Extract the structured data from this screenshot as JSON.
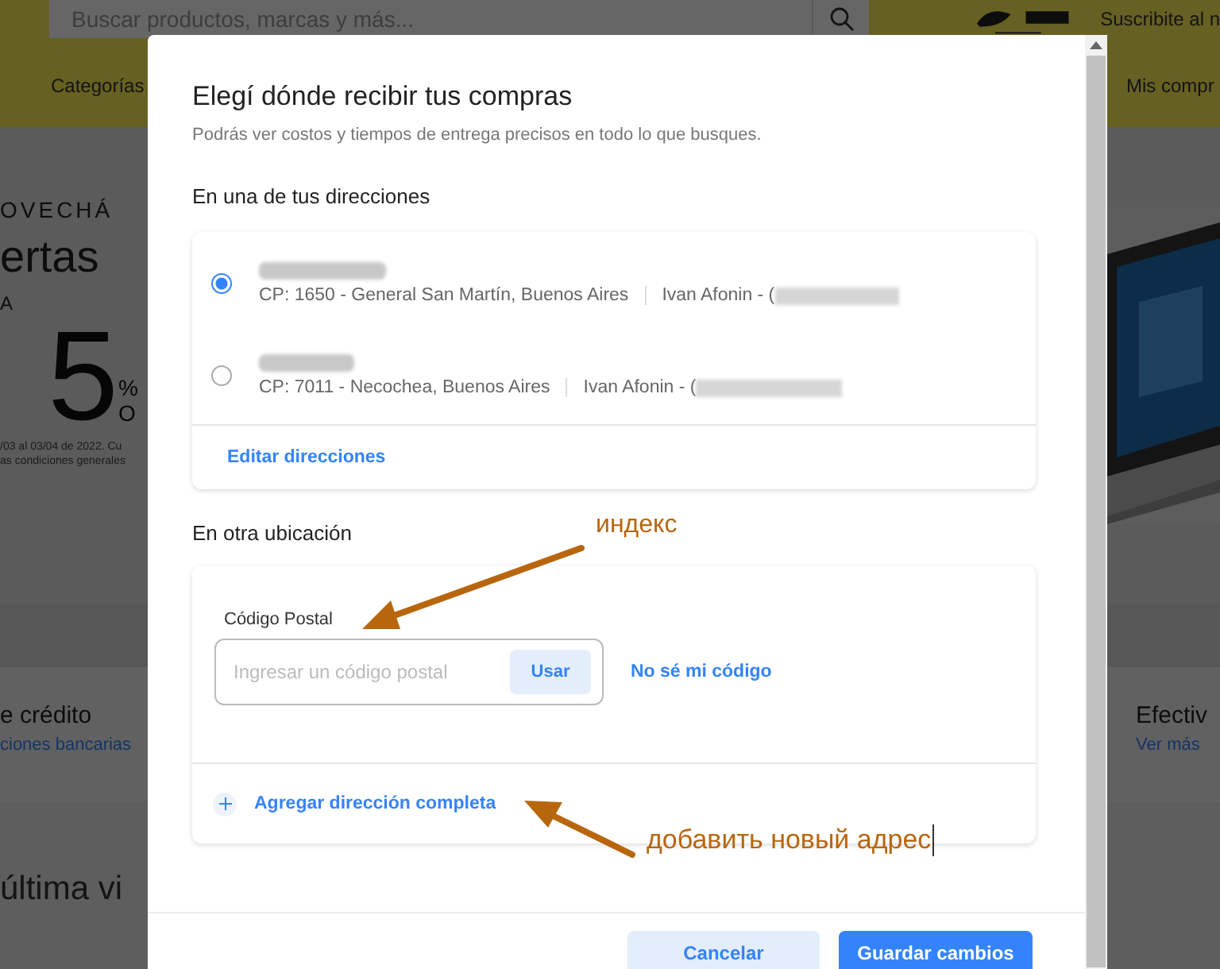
{
  "background_page": {
    "search": {
      "placeholder": "Buscar productos, marcas y más..."
    },
    "promo_text": "Suscribite al n",
    "nav": [
      "Categorías",
      "Mis compr"
    ],
    "hero": {
      "kicker": "OVECHÁ",
      "headline": "ertas",
      "prefix": "A",
      "big": "5",
      "percent": "%",
      "suffix": "O",
      "legal": [
        "/03 al 03/04 de 2022. Cu",
        "as condiciones generales"
      ]
    },
    "payment_cards": [
      {
        "title": "e crédito",
        "link": "ciones bancarias"
      },
      {
        "title": "Efectiv",
        "link": "Ver más"
      }
    ],
    "section_heading": "última vi"
  },
  "modal": {
    "title": "Elegí dónde recibir tus compras",
    "subtitle": "Podrás ver costos y tiempos de entrega precisos en todo lo que busques.",
    "saved_section": {
      "heading": "En una de tus direcciones",
      "addresses": [
        {
          "selected": true,
          "postal": "CP: 1650 - General San Martín, Buenos Aires",
          "contact": "Ivan Afonin - ("
        },
        {
          "selected": false,
          "postal": "CP: 7011 - Necochea, Buenos Aires",
          "contact": "Ivan Afonin - ("
        }
      ],
      "edit_link": "Editar direcciones"
    },
    "other_section": {
      "heading": "En otra ubicación",
      "postal_field": {
        "label": "Código Postal",
        "placeholder": "Ingresar un código postal",
        "button": "Usar"
      },
      "help_link": "No sé mi código",
      "add_link": "Agregar dirección completa"
    },
    "buttons": [
      {
        "label": "Cancelar",
        "kind": "secondary"
      },
      {
        "label": "Guardar cambios",
        "kind": "primary"
      }
    ]
  },
  "annotations": [
    {
      "text": "индекс"
    },
    {
      "text": "добавить новый адрес"
    }
  ]
}
